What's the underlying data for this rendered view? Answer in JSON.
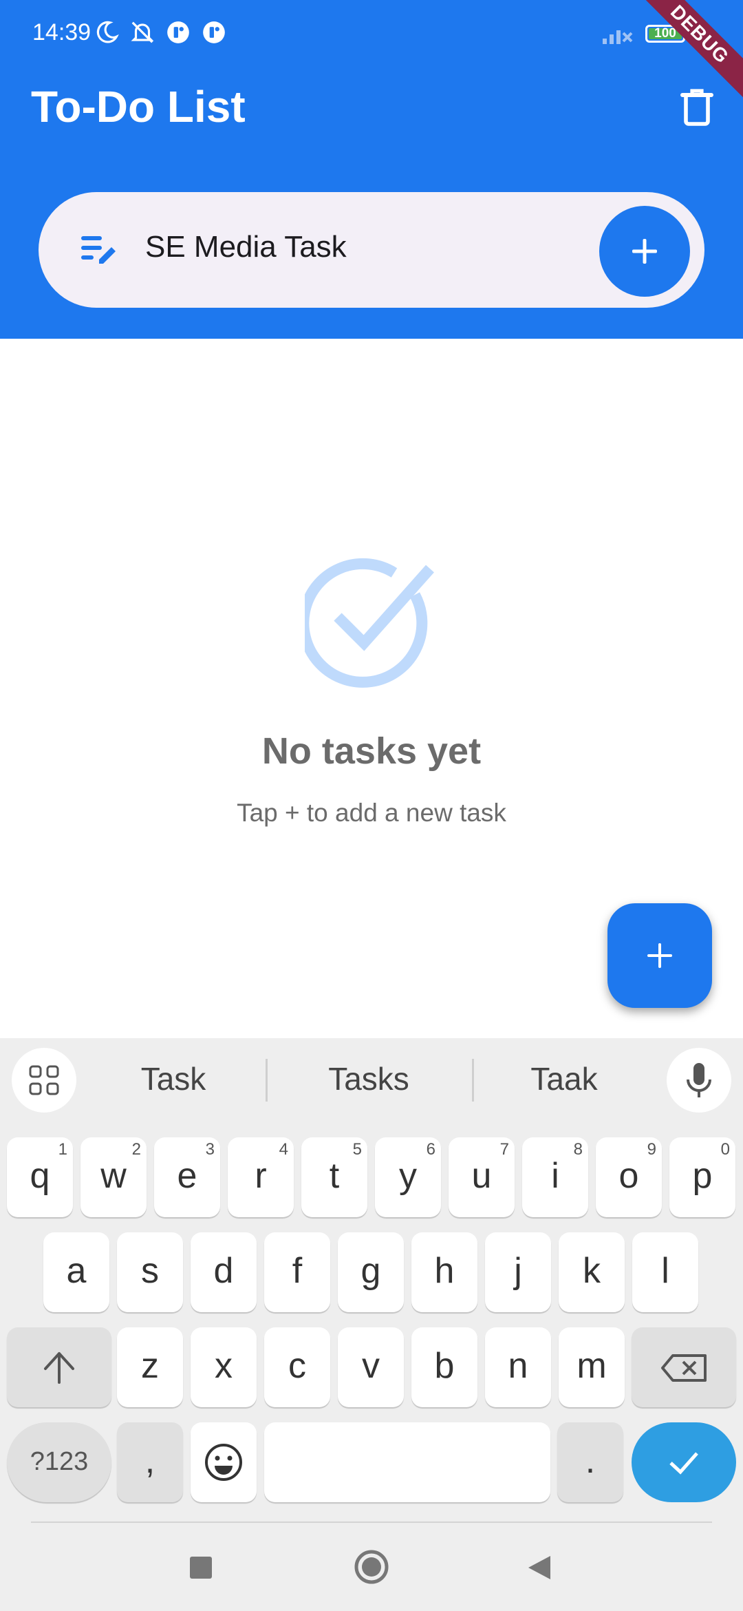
{
  "status_bar": {
    "time": "14:39",
    "battery": "100",
    "debug_banner": "DEBUG",
    "icons": [
      "moon-icon",
      "bell-off-icon",
      "app-notification-icon",
      "app-notification-icon",
      "signal-off-icon",
      "battery-icon"
    ]
  },
  "app_bar": {
    "title": "To-Do List",
    "delete_icon": "trash-icon"
  },
  "task_input": {
    "value": "SE Media Task",
    "icon": "edit-note-icon",
    "add_icon": "plus-icon"
  },
  "empty_state": {
    "icon": "check-circle-icon",
    "title": "No tasks yet",
    "subtitle": "Tap + to add a new task"
  },
  "fab": {
    "icon": "plus-icon"
  },
  "keyboard": {
    "suggestions": [
      "Task",
      "Tasks",
      "Taak"
    ],
    "row1": [
      {
        "l": "q",
        "h": "1"
      },
      {
        "l": "w",
        "h": "2"
      },
      {
        "l": "e",
        "h": "3"
      },
      {
        "l": "r",
        "h": "4"
      },
      {
        "l": "t",
        "h": "5"
      },
      {
        "l": "y",
        "h": "6"
      },
      {
        "l": "u",
        "h": "7"
      },
      {
        "l": "i",
        "h": "8"
      },
      {
        "l": "o",
        "h": "9"
      },
      {
        "l": "p",
        "h": "0"
      }
    ],
    "row2": [
      "a",
      "s",
      "d",
      "f",
      "g",
      "h",
      "j",
      "k",
      "l"
    ],
    "row3": [
      "z",
      "x",
      "c",
      "v",
      "b",
      "n",
      "m"
    ],
    "symbols_key": "?123",
    "comma_key": ",",
    "period_key": "."
  },
  "colors": {
    "primary": "#1e78ee",
    "debug": "#8b2446",
    "enter_key": "#2e9ee2",
    "empty_icon": "#bfdafc"
  }
}
